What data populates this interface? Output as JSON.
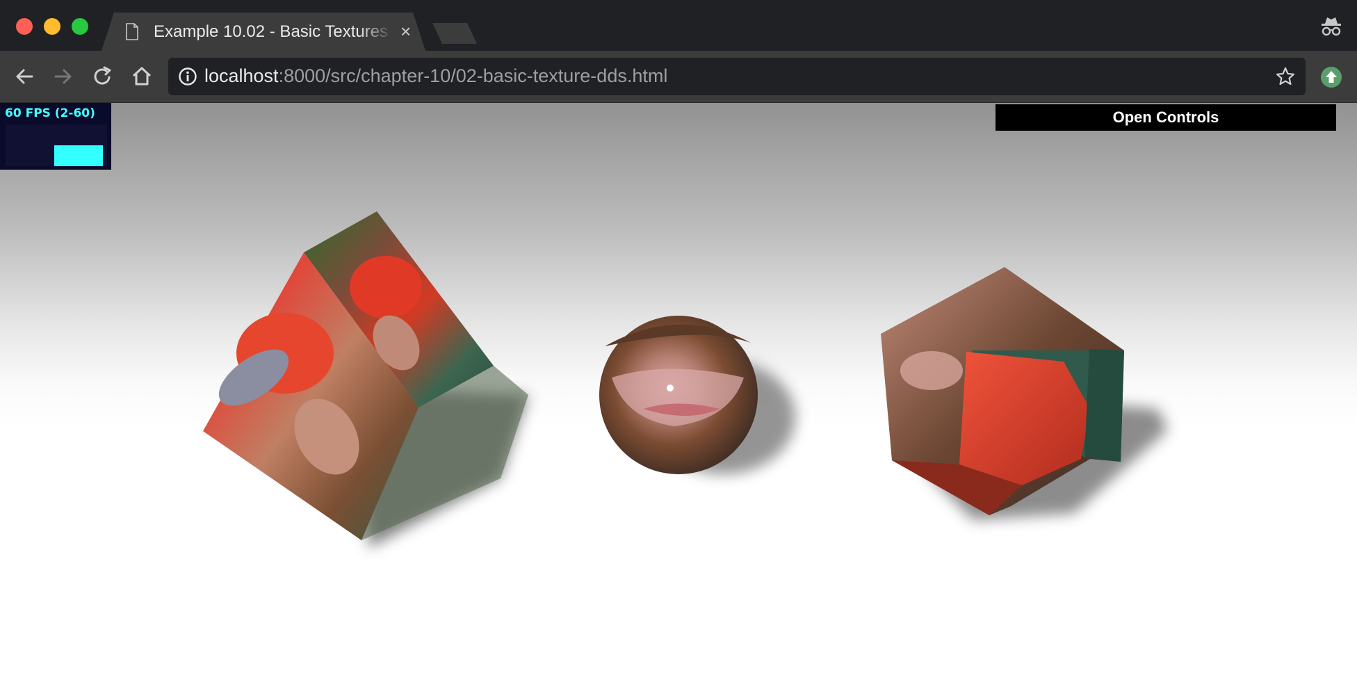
{
  "browser": {
    "tab": {
      "title": "Example 10.02 - Basic Textures"
    },
    "address_bar": {
      "host": "localhost",
      "rest": ":8000/src/chapter-10/02-basic-texture-dds.html"
    },
    "icons": [
      "file-icon",
      "close-icon",
      "incognito-icon",
      "back-icon",
      "forward-icon",
      "reload-icon",
      "home-icon",
      "info-icon",
      "star-icon",
      "extension-icon"
    ],
    "colors": {
      "chrome_dark": "#202124",
      "chrome_toolbar": "#3c3c3c",
      "accent_green": "#5b9e6d"
    }
  },
  "app": {
    "stats": {
      "label": "60 FPS (2-60)",
      "graph_level": 0.5,
      "color": "#33ffff"
    },
    "controls": {
      "label": "Open Controls"
    },
    "scene_objects": [
      "textured-cube",
      "textured-sphere",
      "textured-icosahedron"
    ]
  }
}
